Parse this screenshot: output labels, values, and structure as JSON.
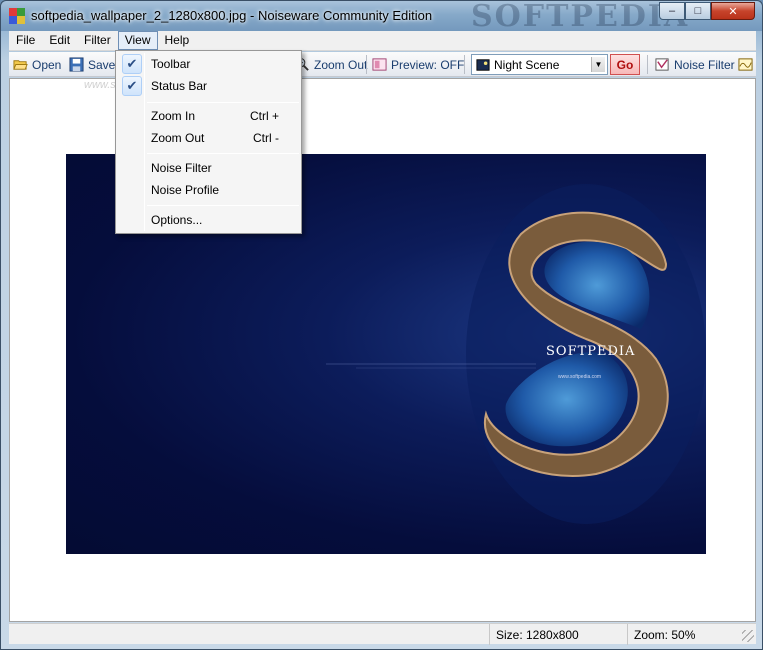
{
  "window": {
    "title": "softpedia_wallpaper_2_1280x800.jpg - Noiseware Community Edition",
    "watermark": "SOFTPEDIA"
  },
  "menu": [
    "File",
    "Edit",
    "Filter",
    "View",
    "Help"
  ],
  "toolbar": {
    "open": "Open",
    "save": "Save",
    "zoom_out": "Zoom Out",
    "preview": "Preview: OFF",
    "preset": "Night Scene",
    "go": "Go",
    "noise_filter": "Noise Filter"
  },
  "view_menu": {
    "items": [
      {
        "label": "Toolbar",
        "checked": true
      },
      {
        "label": "Status Bar",
        "checked": true
      },
      {
        "label": "Zoom In",
        "shortcut": "Ctrl +"
      },
      {
        "label": "Zoom Out",
        "shortcut": "Ctrl -"
      },
      {
        "label": "Noise Filter"
      },
      {
        "label": "Noise Profile"
      },
      {
        "label": "Options..."
      }
    ]
  },
  "image": {
    "watermark": "www.softpedia.com",
    "logo": "SOFTPEDIA",
    "url": "www.softpedia.com"
  },
  "status": {
    "size": "Size: 1280x800",
    "zoom": "Zoom: 50%"
  },
  "colors": {
    "accent": "#1a3d6e",
    "go": "#b01010",
    "night_bg": "#050d3c"
  }
}
